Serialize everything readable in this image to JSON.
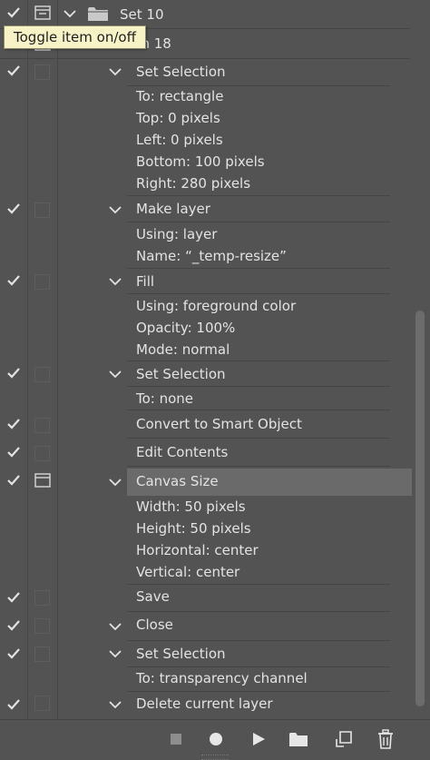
{
  "tooltip": "Toggle item on/off",
  "set": {
    "name": "Set 10"
  },
  "action": {
    "name": "Action 18"
  },
  "steps": [
    {
      "title": "Set Selection",
      "params": [
        "To: rectangle",
        "Top: 0 pixels",
        "Left: 0 pixels",
        "Bottom: 100 pixels",
        "Right: 280 pixels"
      ]
    },
    {
      "title": "Make layer",
      "params": [
        "Using: layer",
        "Name:  “_temp-resize”"
      ]
    },
    {
      "title": "Fill",
      "params": [
        "Using: foreground color",
        "Opacity: 100%",
        "Mode: normal"
      ]
    },
    {
      "title": "Set Selection",
      "params": [
        "To: none"
      ]
    },
    {
      "title": "Convert to Smart Object"
    },
    {
      "title": "Edit Contents"
    },
    {
      "title": "Canvas Size",
      "params": [
        "Width: 50 pixels",
        "Height: 50 pixels",
        "Horizontal: center",
        "Vertical: center"
      ]
    },
    {
      "title": "Save"
    },
    {
      "title": "Close"
    },
    {
      "title": "Set Selection",
      "params": [
        "To: transparency channel"
      ]
    },
    {
      "title": "Delete current layer"
    }
  ],
  "icons": {
    "stop": "stop-icon",
    "record": "record-icon",
    "play": "play-icon",
    "new_set": "folder-icon",
    "new_action": "new-action-icon",
    "delete": "trash-icon"
  },
  "colors": {
    "panel_bg": "#535353",
    "highlight": "#6a6a6a",
    "tooltip_bg": "#f7f3c7"
  }
}
